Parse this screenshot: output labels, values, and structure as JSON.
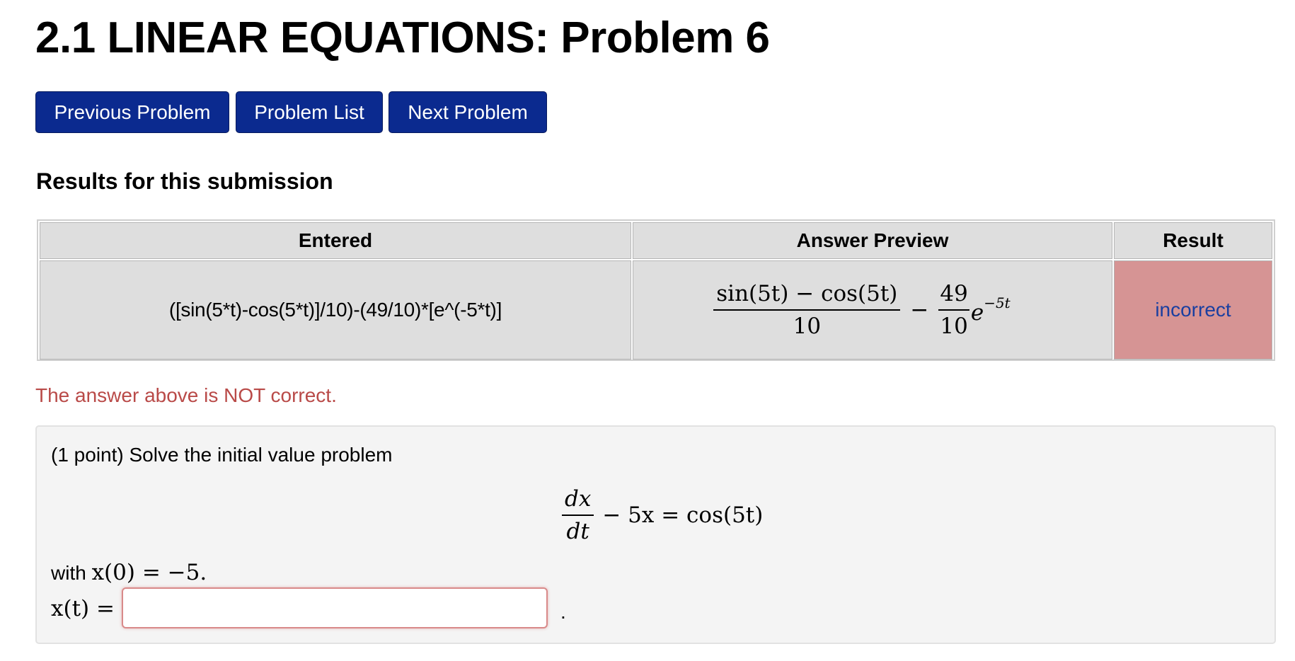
{
  "title": "2.1 LINEAR EQUATIONS: Problem 6",
  "nav": {
    "previous": "Previous Problem",
    "list": "Problem List",
    "next": "Next Problem"
  },
  "results": {
    "heading": "Results for this submission",
    "columns": [
      "Entered",
      "Answer Preview",
      "Result"
    ],
    "row": {
      "entered": "([sin(5*t)-cos(5*t)]/10)-(49/10)*[e^(-5*t)]",
      "preview": {
        "frac1_num": "sin(5t) − cos(5t)",
        "frac1_den": "10",
        "minus": "−",
        "frac2_num": "49",
        "frac2_den": "10",
        "base": "e",
        "exponent": "−5t"
      },
      "result": "incorrect"
    },
    "result_color": "#d69494"
  },
  "status_message": "The answer above is NOT correct.",
  "problem": {
    "intro": "(1 point) Solve the initial value problem",
    "equation": {
      "num": "dx",
      "den": "dt",
      "rest": "− 5x = cos(5t)"
    },
    "condition_prefix": "with",
    "condition": "x(0) = −5.",
    "answer_label": "x(t) =",
    "answer_value": "",
    "answer_placeholder": "",
    "trailing": "."
  },
  "colors": {
    "button": "#0b2a8f",
    "error_text": "#b94a48",
    "result_link": "#1a3fa0"
  }
}
